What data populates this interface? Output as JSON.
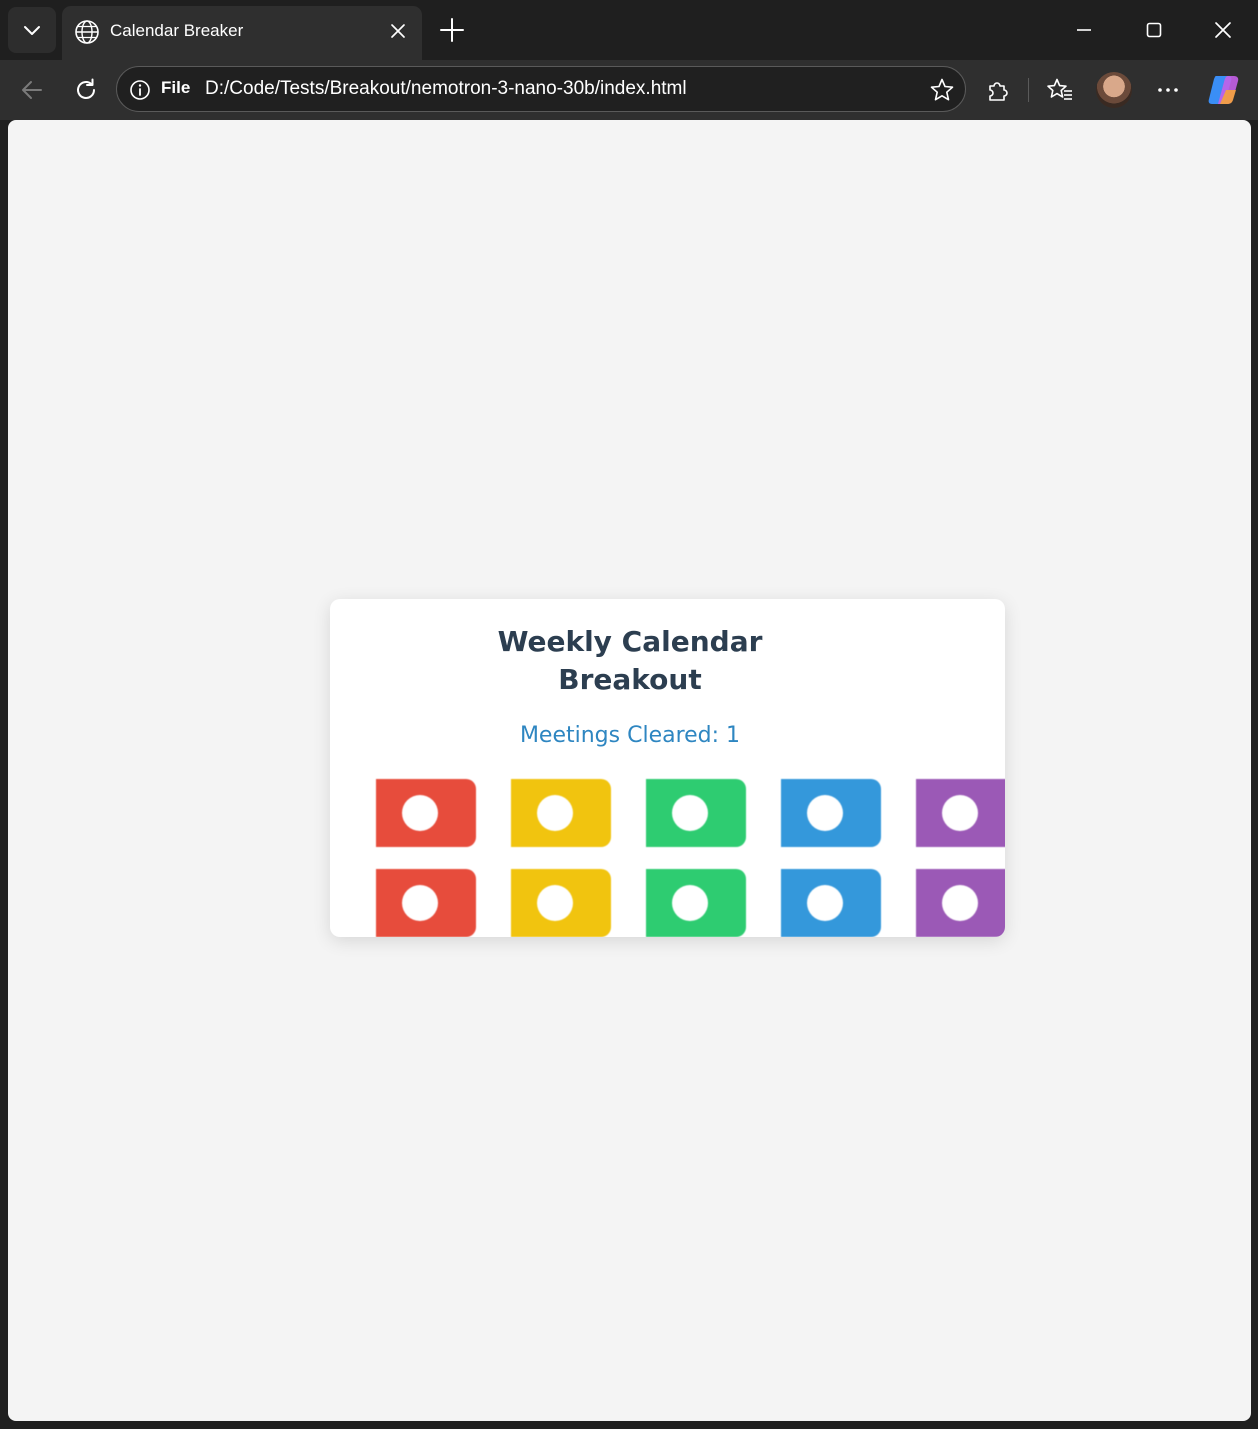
{
  "browser": {
    "tab": {
      "title": "Calendar Breaker"
    },
    "omnibox": {
      "scheme_label": "File",
      "url": "D:/Code/Tests/Breakout/nemotron-3-nano-30b/index.html"
    }
  },
  "game": {
    "title_line1": "Weekly Calendar",
    "title_line2": "Breakout",
    "score_label": "Meetings Cleared: 1",
    "brick_colors": [
      "#e74c3c",
      "#f1c40f",
      "#2ecc71",
      "#3498db",
      "#9b59b6"
    ],
    "brick_rows": 2
  },
  "icons": {
    "tab_list": "chevron-down-icon",
    "favicon": "globe-icon",
    "tab_close": "close-icon",
    "new_tab": "plus-icon",
    "minimize": "minimize-icon",
    "maximize": "maximize-icon",
    "close_window": "close-icon",
    "back": "arrow-left-icon",
    "reload": "reload-icon",
    "site_info": "info-icon",
    "favorite": "star-icon",
    "extensions": "puzzle-icon",
    "favorites": "favorites-icon",
    "more": "ellipsis-icon",
    "copilot": "copilot-icon"
  }
}
